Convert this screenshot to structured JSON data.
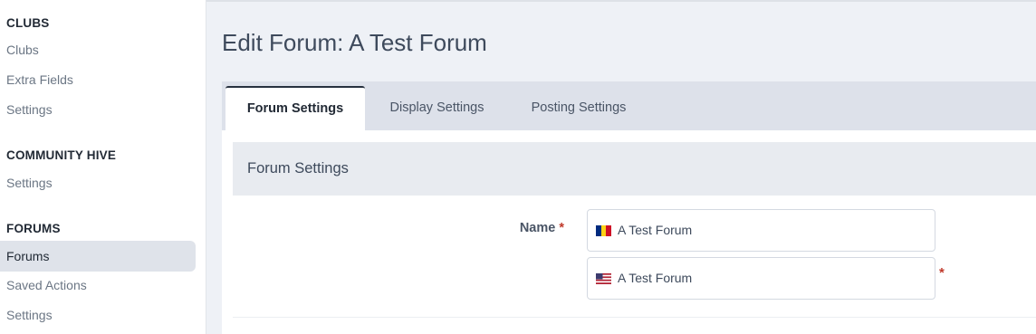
{
  "sidebar": {
    "sections": [
      {
        "title": "CLUBS",
        "items": [
          "Clubs",
          "Extra Fields",
          "Settings"
        ]
      },
      {
        "title": "COMMUNITY HIVE",
        "items": [
          "Settings"
        ]
      },
      {
        "title": "FORUMS",
        "items": [
          "Forums",
          "Saved Actions",
          "Settings"
        ]
      }
    ],
    "active_item": "Forums"
  },
  "page": {
    "title": "Edit Forum: A Test Forum"
  },
  "tabs": [
    {
      "label": "Forum Settings",
      "active": true
    },
    {
      "label": "Display Settings",
      "active": false
    },
    {
      "label": "Posting Settings",
      "active": false
    }
  ],
  "form": {
    "section_title": "Forum Settings",
    "name_label": "Name",
    "required_mark": "*",
    "name_values": [
      {
        "flag": "romania-flag-icon",
        "value": "A Test Forum"
      },
      {
        "flag": "us-flag-icon",
        "value": "A Test Forum"
      }
    ]
  },
  "colors": {
    "required": "#c0392b",
    "active_tab_border": "#27313f",
    "sidebar_active": "#dfe3ea"
  }
}
